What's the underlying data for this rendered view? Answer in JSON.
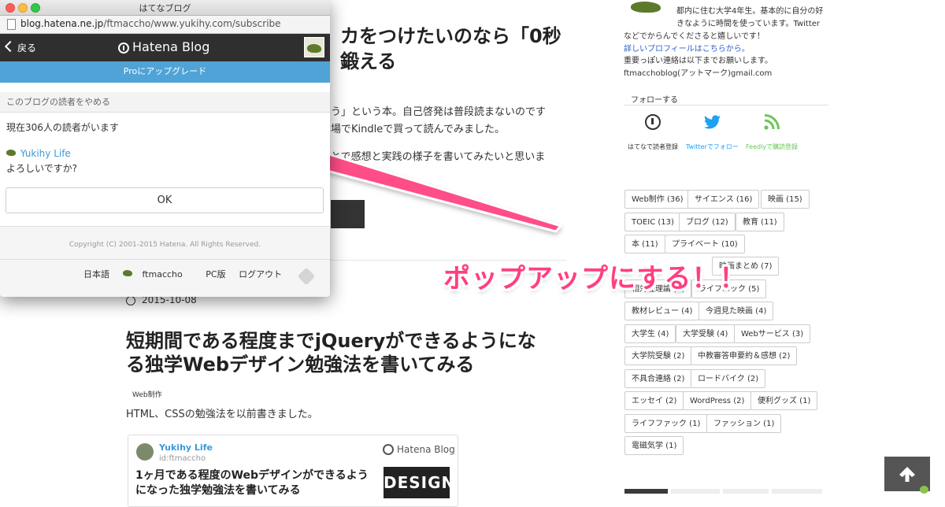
{
  "blog_page": {
    "article1": {
      "title_line1": "カをつけたいのなら「0秒",
      "title_line2": "鍛える",
      "para1_line1": "う」という本。自己啓発は普段読まないのです",
      "para1_line2": "場でKindleで買って読んでみました。",
      "para2_line1": "とで感想と実践の様子を書いてみたいと思いま",
      "para2_line2": "す"
    },
    "article2": {
      "date": "2015-10-08",
      "title_line1": "短期間である程度までjQueryができるようにな",
      "title_line2": "る独学Webデザイン勉強法を書いてみる",
      "category": "Web制作",
      "intro": "HTML、CSSの勉強法を以前書きました。",
      "embed": {
        "blog_name": "Yukihy Life",
        "blog_id": "id:ftmaccho",
        "logo_text": "Hatena Blog",
        "title_line1": "1ヶ月である程度のWebデザインができるよう",
        "title_line2": "になった独学勉強法を書いてみる",
        "thumb_text": "DESIGN"
      }
    }
  },
  "sidebar": {
    "profile_line1": "都内に住む大学4年生。基本的に自分の好",
    "profile_line2": "きなように時間を使っています。Twitter",
    "profile_line3": "などでからんでくださると嬉しいです！",
    "profile_link": "詳しいプロフィールはこちらから。",
    "contact_line": "重要っぽい連絡は以下までお願いします。",
    "email": "ftmacchoblog(アットマーク)gmail.com",
    "follow_heading": "フォローする",
    "follow_buttons": [
      {
        "label": "はてなで読者登録",
        "icon": "hatena-icon",
        "color": "#333333"
      },
      {
        "label": "Twitterでフォロー",
        "icon": "twitter-icon",
        "color": "#1da1f2"
      },
      {
        "label": "Feedlyで購読登録",
        "icon": "feedly-icon",
        "color": "#6cc655"
      }
    ],
    "tags": [
      "Web制作 (36)",
      "サイエンス (16)",
      "映画 (15)",
      "TOEIC (13)",
      "ブログ (12)",
      "教育 (11)",
      "本 (11)",
      "プライベート (10)",
      "",
      "映画まとめ (7)",
      "相対性理論 (7)",
      "ライフハック (5)",
      "教材レビュー (4)",
      "今週見た映画 (4)",
      "大学生 (4)",
      "大学受験 (4)",
      "Webサービス (3)",
      "大学院受験 (2)",
      "中教審答申要約＆感想 (2)",
      "不具合連絡 (2)",
      "ロードバイク (2)",
      "エッセイ (2)",
      "WordPress (2)",
      "便利グッズ (1)",
      "ライフファック (1)",
      "ファッション (1)",
      "電磁気学 (1)"
    ]
  },
  "popup": {
    "window_title": "はてなブログ",
    "url_host": "blog.hatena.ne.jp",
    "url_path": "/ftmaccho/www.yukihy.com/subscribe",
    "back_label": "戻る",
    "logo_text": "Hatena Blog",
    "upgrade_label": "Proにアップグレード",
    "section_heading": "このブログの読者をやめる",
    "readers_text": "現在306人の読者がいます",
    "blog_name": "Yukihy Life",
    "confirm_text": "よろしいですか?",
    "ok_label": "OK",
    "copyright": "Copyright (C) 2001-2015 Hatena. All Rights Reserved.",
    "footer_links": {
      "lang": "日本語",
      "user": "ftmaccho",
      "pc": "PC版",
      "logout": "ログアウト"
    }
  },
  "annotation": {
    "text": "ポップアップにする！！",
    "color": "#ff3f7e"
  }
}
